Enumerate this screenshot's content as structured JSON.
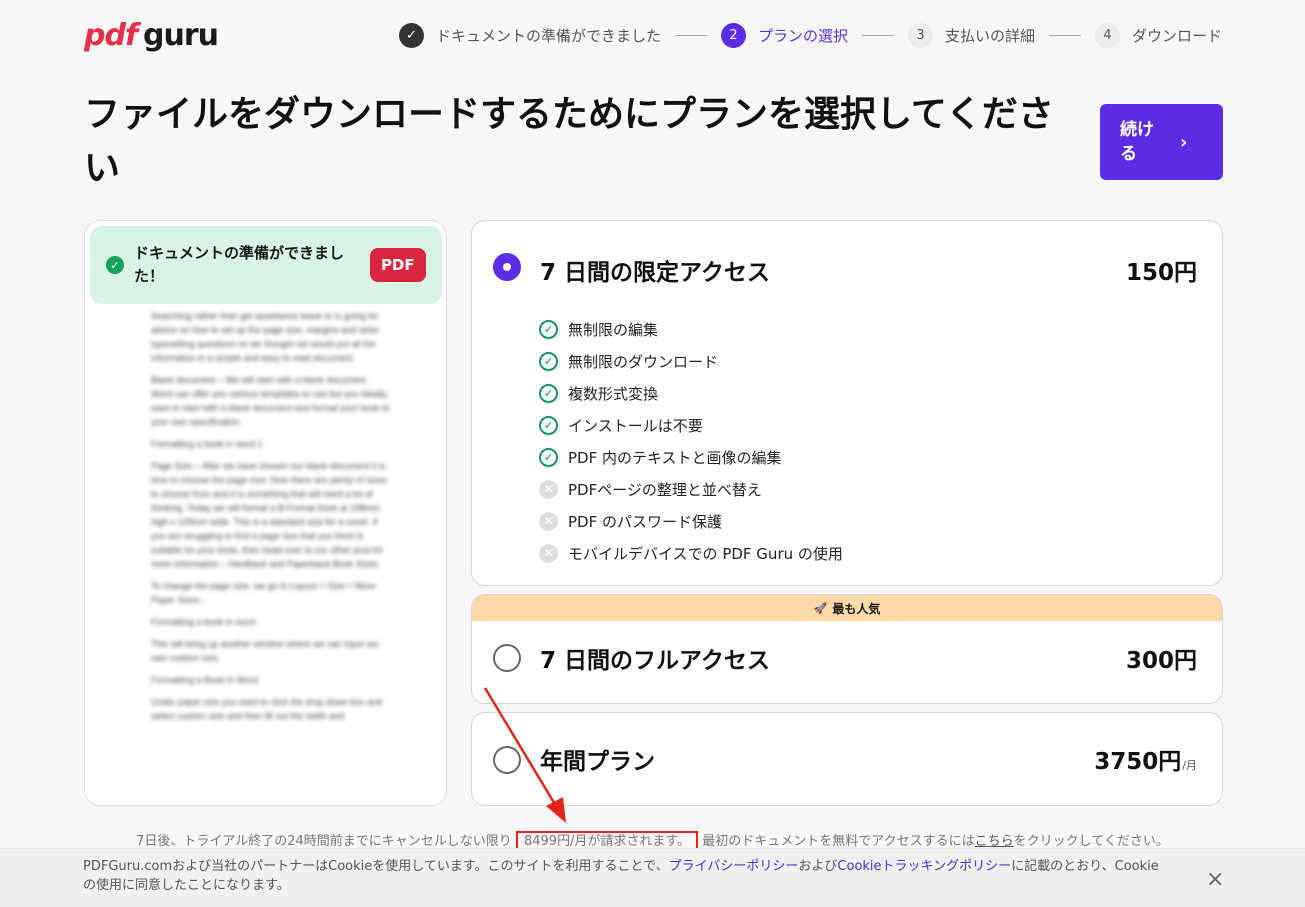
{
  "logo": {
    "pdf": "pdf",
    "guru": "guru"
  },
  "steps": [
    {
      "label": "ドキュメントの準備ができました",
      "num": "✓"
    },
    {
      "label": "プランの選択",
      "num": "2"
    },
    {
      "label": "支払いの詳細",
      "num": "3"
    },
    {
      "label": "ダウンロード",
      "num": "4"
    }
  ],
  "title": "ファイルをダウンロードするためにプランを選択してください",
  "continue_button": {
    "label": "続ける",
    "chevron": "›"
  },
  "preview": {
    "ready_text": "ドキュメントの準備ができました！",
    "badge": "PDF",
    "doc_paragraphs": [
      "Searching rather than get assistance leave or is going for advice on how to set up the page size, margins and other typesetting questions so we thought we would put all the information in a simple and easy to read document.",
      "Blank document – We will start with a blank document. Word can offer you various templates to use but you ideally want to start with a blank document and format your book to your own specification.",
      "Formatting a book in word 1",
      "Page Size – After we have chosen our blank document it is time to choose the page size. Now there are plenty of sizes to choose from and it is something that will need a lot of thinking. Today we will format a B-Format book at 198mm high x 129mm wide. This is a standard size for a novel. If you are struggling to find a page size that you think is suitable for your book, then head over to our other post for more information – Hardback and Paperback Book Sizes.",
      "To change the page size, we go to Layout > Size > More Paper Sizes...",
      "Formatting a book in word",
      "This will bring up another window where we can input our own custom size.",
      "Formatting a Book in Word",
      "Under paper size you want to click the drop down box and select custom size and then fill out the width and"
    ]
  },
  "plans": [
    {
      "name": "7 日間の限定アクセス",
      "price": "150円",
      "unit": "",
      "features": [
        {
          "text": "無制限の編集",
          "included": true
        },
        {
          "text": "無制限のダウンロード",
          "included": true
        },
        {
          "text": "複数形式変換",
          "included": true
        },
        {
          "text": "インストールは不要",
          "included": true
        },
        {
          "text": "PDF 内のテキストと画像の編集",
          "included": true
        },
        {
          "text": "PDFページの整理と並べ替え",
          "included": false
        },
        {
          "text": "PDF のパスワード保護",
          "included": false
        },
        {
          "text": "モバイルデバイスでの PDF Guru の使用",
          "included": false
        }
      ]
    },
    {
      "name": "7 日間のフルアクセス",
      "price": "300円",
      "unit": "",
      "badge": "最も人気"
    },
    {
      "name": "年間プラン",
      "price": "3750円",
      "unit": "/月"
    }
  ],
  "terms": {
    "before": "7日後、トライアル終了の24時間前までにキャンセルしない限り",
    "highlight": "8499円/月が請求されます。",
    "middle": "最初のドキュメントを無料でアクセスするには",
    "link": "こちら",
    "after": "をクリックしてください。"
  },
  "cookie": {
    "text1": "PDFGuru.comおよび当社のパートナーはCookieを使用しています。このサイトを利用することで、",
    "link1": "プライバシーポリシー",
    "text2": "および",
    "link2": "Cookieトラッキングポリシー",
    "text3": "に記載のとおり、Cookieの使用に同意したことになります。",
    "close": "×"
  },
  "colors": {
    "accent": "#5b2ee5",
    "brand_red": "#e3314a",
    "success": "#16a05d",
    "annotation_red": "#e0261b",
    "popular": "#fcd9a6"
  }
}
